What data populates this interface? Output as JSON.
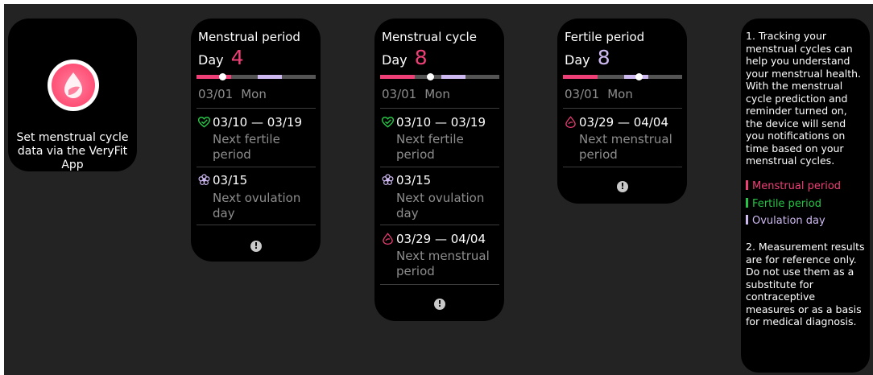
{
  "colors": {
    "menstrual": "#ee3f76",
    "fertile": "#26c346",
    "ovulation": "#cdb8f0",
    "muted_text": "#8d8d8d",
    "background": "#232323"
  },
  "setup_card": {
    "logo_icon": "menstrual-app-logo",
    "text": "Set menstrual cycle data via the VeryFit App"
  },
  "screens": [
    {
      "title": "Menstrual period",
      "day_label": "Day",
      "day_number": "4",
      "day_number_color": "#ee3f76",
      "timeline_position": 0.22,
      "date": "03/01",
      "weekday": "Mon",
      "items": [
        {
          "icon": "heart-outline-icon",
          "title": "03/10 — 03/19",
          "subtitle": "Next fertile period"
        },
        {
          "icon": "flower-icon",
          "title": "03/15",
          "subtitle": "Next ovulation day"
        }
      ]
    },
    {
      "title": "Menstrual cycle",
      "day_label": "Day",
      "day_number": "8",
      "day_number_color": "#ee3f76",
      "timeline_position": 0.42,
      "date": "03/01",
      "weekday": "Mon",
      "items": [
        {
          "icon": "heart-outline-icon",
          "title": "03/10 — 03/19",
          "subtitle": "Next fertile period"
        },
        {
          "icon": "flower-icon",
          "title": "03/15",
          "subtitle": "Next ovulation day"
        },
        {
          "icon": "menstrual-drop-icon",
          "title": "03/29 — 04/04",
          "subtitle": "Next menstrual period"
        }
      ]
    },
    {
      "title": "Fertile period",
      "day_label": "Day",
      "day_number": "8",
      "day_number_color": "#cdb8f0",
      "timeline_position": 0.64,
      "date": "03/01",
      "weekday": "Mon",
      "items": [
        {
          "icon": "menstrual-drop-icon",
          "title": "03/29 — 04/04",
          "subtitle": "Next menstrual period"
        }
      ]
    }
  ],
  "notes": {
    "note1": "1. Tracking your menstrual cycles can help you understand your menstrual health. With the menstrual cycle prediction and reminder turned on, the device will send you notifications on time based on your menstrual cycles.",
    "legend": [
      {
        "label": "Menstrual period",
        "color": "#ee3f76"
      },
      {
        "label": "Fertile period",
        "color": "#26c346"
      },
      {
        "label": "Ovulation day",
        "color": "#cdb8f0"
      }
    ],
    "note2": "2. Measurement results are for reference only. Do not use them as a substitute for contraceptive measures or as a basis for medical diagnosis."
  }
}
